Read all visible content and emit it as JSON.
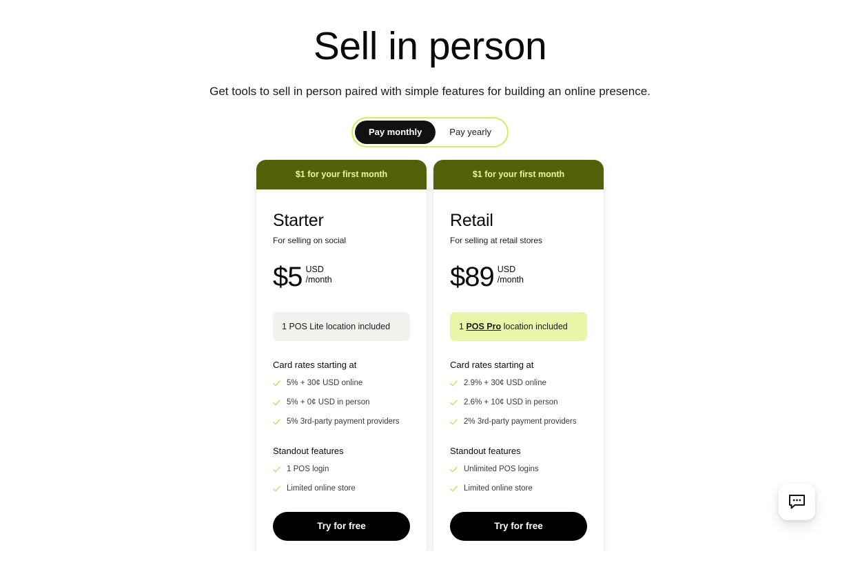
{
  "page": {
    "background_top_color": "#bccfc3",
    "background_bottom_color": "#edf3ee",
    "surface_color": "#ffffff"
  },
  "hero": {
    "title": "Sell in person",
    "subtitle": "Get tools to sell in person paired with simple features for building an online presence."
  },
  "billing_toggle": {
    "name": "billing-period-toggle",
    "border_color": "#d5ea5c",
    "active_pill_color": "#111111",
    "selected": "Pay monthly",
    "options": [
      {
        "label": "Pay monthly",
        "selected": true
      },
      {
        "label": "Pay yearly",
        "selected": false
      }
    ]
  },
  "plans": [
    {
      "banner": "$1 for your first month",
      "banner_bg": "#55610a",
      "banner_text_color": "#e8f5a0",
      "name": "Starter",
      "tagline": "For selling on social",
      "price": "$5",
      "currency": "USD",
      "period": "/month",
      "location_chip": {
        "prefix": "1 ",
        "strong": "POS Lite",
        "suffix": " location included",
        "style": "neutral",
        "bg": "#f2f1ee"
      },
      "rates_heading": "Card rates starting at",
      "rates": [
        "5% + 30¢ USD online",
        "5% + 0¢ USD in person",
        "5% 3rd-party payment providers"
      ],
      "features_heading": "Standout features",
      "features": [
        "1 POS login",
        "Limited online store"
      ],
      "cta": "Try for free"
    },
    {
      "banner": "$1 for your first month",
      "banner_bg": "#55610a",
      "banner_text_color": "#e8f5a0",
      "name": "Retail",
      "tagline": "For selling at retail stores",
      "price": "$89",
      "currency": "USD",
      "period": "/month",
      "location_chip": {
        "prefix": "1 ",
        "strong": "POS Pro",
        "suffix": " location included",
        "style": "highlight",
        "bg": "#e9f5a8"
      },
      "rates_heading": "Card rates starting at",
      "rates": [
        "2.9% + 30¢ USD online",
        "2.6% + 10¢ USD in person",
        "2% 3rd-party payment providers"
      ],
      "features_heading": "Standout features",
      "features": [
        "Unlimited POS logins",
        "Limited online store"
      ],
      "cta": "Try for free"
    }
  ],
  "chat_launcher": {
    "icon": "chat-bubble-icon",
    "aria_label": "Open chat"
  },
  "icons": {
    "check": "check-icon",
    "check_color": "#c7d96b"
  }
}
